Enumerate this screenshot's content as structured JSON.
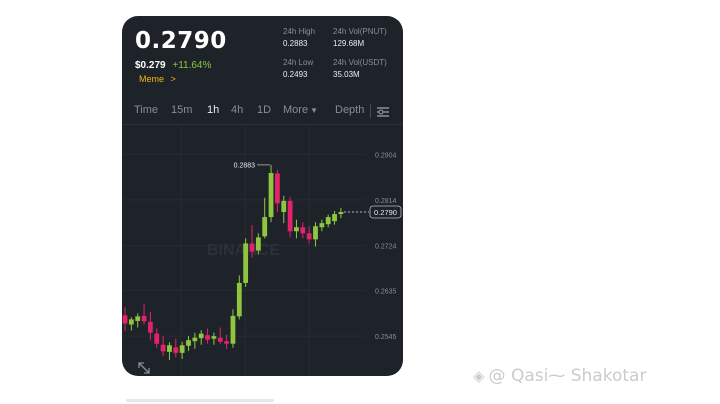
{
  "ticker": {
    "price": "0.2790",
    "usd_price": "$0.279",
    "change": "+11.64%",
    "tag": "Meme",
    "tag_arrow": ">"
  },
  "stats": {
    "high_label": "24h High",
    "high_value": "0.2883",
    "low_label": "24h Low",
    "low_value": "0.2493",
    "vol_base_label": "24h Vol(PNUT)",
    "vol_base_value": "129.68M",
    "vol_quote_label": "24h Vol(USDT)",
    "vol_quote_value": "35.03M"
  },
  "tabs": {
    "time": "Time",
    "m15": "15m",
    "h1": "1h",
    "h4": "4h",
    "d1": "1D",
    "more": "More",
    "more_caret": "▼",
    "depth": "Depth"
  },
  "colors": {
    "up": "#8fc63f",
    "down": "#e2226b",
    "background": "#1e2329",
    "accent": "#f0b90b"
  },
  "chart_data": {
    "type": "candlestick",
    "y_ticks": [
      "0.2904",
      "0.2814",
      "0.2724",
      "0.2635",
      "0.2545"
    ],
    "ylim": [
      0.2492,
      0.2942
    ],
    "high_annotation": "0.2883",
    "current_price_label": "0.2790",
    "watermark": "BINANCE",
    "candles": [
      {
        "o": 0.2586,
        "h": 0.2602,
        "l": 0.2555,
        "c": 0.257
      },
      {
        "o": 0.2568,
        "h": 0.2582,
        "l": 0.2556,
        "c": 0.2578
      },
      {
        "o": 0.2575,
        "h": 0.259,
        "l": 0.2562,
        "c": 0.2584
      },
      {
        "o": 0.2585,
        "h": 0.2608,
        "l": 0.2568,
        "c": 0.2574
      },
      {
        "o": 0.2573,
        "h": 0.2593,
        "l": 0.2537,
        "c": 0.2552
      },
      {
        "o": 0.255,
        "h": 0.256,
        "l": 0.2522,
        "c": 0.253
      },
      {
        "o": 0.2528,
        "h": 0.2545,
        "l": 0.2505,
        "c": 0.2515
      },
      {
        "o": 0.2514,
        "h": 0.2533,
        "l": 0.2498,
        "c": 0.2527
      },
      {
        "o": 0.2523,
        "h": 0.254,
        "l": 0.2503,
        "c": 0.2512
      },
      {
        "o": 0.2512,
        "h": 0.2534,
        "l": 0.25,
        "c": 0.2527
      },
      {
        "o": 0.2526,
        "h": 0.2545,
        "l": 0.2516,
        "c": 0.2537
      },
      {
        "o": 0.2535,
        "h": 0.2552,
        "l": 0.252,
        "c": 0.2542
      },
      {
        "o": 0.2541,
        "h": 0.2557,
        "l": 0.2528,
        "c": 0.255
      },
      {
        "o": 0.2547,
        "h": 0.256,
        "l": 0.253,
        "c": 0.2538
      },
      {
        "o": 0.254,
        "h": 0.2552,
        "l": 0.2528,
        "c": 0.2545
      },
      {
        "o": 0.2542,
        "h": 0.2562,
        "l": 0.253,
        "c": 0.2534
      },
      {
        "o": 0.2535,
        "h": 0.2548,
        "l": 0.252,
        "c": 0.253
      },
      {
        "o": 0.253,
        "h": 0.2598,
        "l": 0.2522,
        "c": 0.2585
      },
      {
        "o": 0.2584,
        "h": 0.2665,
        "l": 0.2578,
        "c": 0.265
      },
      {
        "o": 0.265,
        "h": 0.2738,
        "l": 0.2642,
        "c": 0.2728
      },
      {
        "o": 0.2728,
        "h": 0.2764,
        "l": 0.27,
        "c": 0.2712
      },
      {
        "o": 0.2714,
        "h": 0.2748,
        "l": 0.2706,
        "c": 0.274
      },
      {
        "o": 0.2742,
        "h": 0.2818,
        "l": 0.2738,
        "c": 0.278
      },
      {
        "o": 0.278,
        "h": 0.2883,
        "l": 0.277,
        "c": 0.2867
      },
      {
        "o": 0.2866,
        "h": 0.2873,
        "l": 0.279,
        "c": 0.2807
      },
      {
        "o": 0.279,
        "h": 0.2822,
        "l": 0.2768,
        "c": 0.2812
      },
      {
        "o": 0.2812,
        "h": 0.282,
        "l": 0.274,
        "c": 0.2752
      },
      {
        "o": 0.2752,
        "h": 0.2775,
        "l": 0.2738,
        "c": 0.276
      },
      {
        "o": 0.276,
        "h": 0.277,
        "l": 0.2738,
        "c": 0.2748
      },
      {
        "o": 0.2748,
        "h": 0.2762,
        "l": 0.2728,
        "c": 0.2736
      },
      {
        "o": 0.2736,
        "h": 0.277,
        "l": 0.2722,
        "c": 0.2762
      },
      {
        "o": 0.276,
        "h": 0.2775,
        "l": 0.2752,
        "c": 0.2768
      },
      {
        "o": 0.2766,
        "h": 0.2785,
        "l": 0.276,
        "c": 0.278
      },
      {
        "o": 0.2772,
        "h": 0.2792,
        "l": 0.2765,
        "c": 0.2786
      },
      {
        "o": 0.2786,
        "h": 0.2798,
        "l": 0.2778,
        "c": 0.279
      }
    ]
  }
}
